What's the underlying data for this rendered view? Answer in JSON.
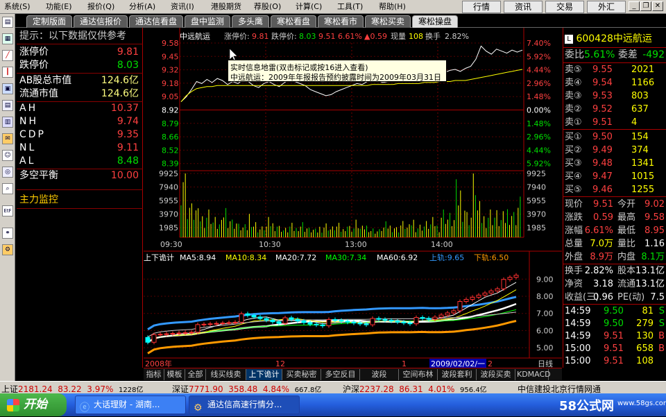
{
  "menu": {
    "items": [
      "系统(S)",
      "功能(E)",
      "报价(Q)",
      "分析(A)",
      "资讯(I)",
      "港股期货",
      "荐股(O)",
      "计算(C)",
      "工具(T)",
      "帮助(H)"
    ],
    "right_buttons": [
      "行情",
      "资讯",
      "交易",
      "外汇"
    ]
  },
  "tabs": [
    "定制版面",
    "通达信报价",
    "通达信看盘",
    "盘中监测",
    "多头鹰",
    "寒松看盘",
    "寒松看市",
    "寒松买卖",
    "寒松操盘"
  ],
  "active_tab": "寒松操盘",
  "left_panel": {
    "notice": "提示：以下数据仅供参考",
    "rows": [
      {
        "label": "涨停价",
        "value": "9.81",
        "color": "#ff4040"
      },
      {
        "label": "跌停价",
        "value": "8.03",
        "color": "#00e000"
      }
    ],
    "cap_rows": [
      {
        "label": "AB股总市值",
        "value": "124.6亿"
      },
      {
        "label": "流通市值",
        "value": "124.6亿"
      }
    ],
    "indicators": [
      {
        "label": "AH",
        "value": "10.37",
        "color": "#ff4040"
      },
      {
        "label": "NH",
        "value": "9.74",
        "color": "#ff4040"
      },
      {
        "label": "CDP",
        "value": "9.35",
        "color": "#ff4040"
      },
      {
        "label": "NL",
        "value": "9.11",
        "color": "#ff4040"
      },
      {
        "label": "AL",
        "value": "8.48",
        "color": "#00e000"
      }
    ],
    "balance": {
      "label": "多空平衡",
      "value": "10.00"
    },
    "monitor_label": "主力监控"
  },
  "intraday": {
    "header": {
      "name": "中远航运",
      "limit_up_label": "涨停价:",
      "limit_up": "9.81",
      "limit_down_label": "跌停价:",
      "limit_down": "8.03",
      "price": "9.51",
      "pct": "6.61%",
      "change": "▲0.59",
      "volume_label": "现量",
      "volume": "108",
      "turnover_label": "换手",
      "turnover": "2.82%"
    },
    "price_ticks": [
      "9.58",
      "9.45",
      "9.32",
      "9.18",
      "9.05",
      "8.92",
      "8.79",
      "8.66",
      "8.52",
      "8.39"
    ],
    "pct_ticks": [
      "7.40%",
      "5.92%",
      "4.44%",
      "2.96%",
      "1.48%",
      "0.00%",
      "1.48%",
      "2.96%",
      "4.44%",
      "5.92%"
    ],
    "vol_ticks": [
      "9925",
      "7940",
      "5955",
      "3970",
      "1985"
    ],
    "time_ticks": [
      "09:30",
      "10:30",
      "13:00",
      "14:00"
    ],
    "price_path": [
      9.0,
      9.05,
      9.12,
      9.2,
      9.18,
      9.22,
      9.19,
      9.23,
      9.21,
      9.17,
      9.2,
      9.18,
      9.22,
      9.2,
      9.16,
      9.14,
      9.18,
      9.2,
      9.17,
      9.15,
      9.19,
      9.22,
      9.2,
      9.18,
      9.16,
      9.12,
      9.1,
      9.08,
      9.06,
      9.07,
      9.1,
      9.12,
      9.14,
      9.16,
      9.18,
      9.17,
      9.2,
      9.22,
      9.21,
      9.19,
      9.2,
      9.22,
      9.24,
      9.23,
      9.25,
      9.24,
      9.26,
      9.25,
      9.27,
      9.28,
      9.3,
      9.29,
      9.31,
      9.32,
      9.3,
      9.33,
      9.35,
      9.42,
      9.55,
      9.5,
      9.47,
      9.52,
      9.5,
      9.48,
      9.51,
      9.49,
      9.51
    ],
    "avg_path": [
      9.0,
      9.06,
      9.1,
      9.13,
      9.14,
      9.15,
      9.15,
      9.16,
      9.16,
      9.16,
      9.16,
      9.16,
      9.16,
      9.16,
      9.16,
      9.16,
      9.16,
      9.16,
      9.16,
      9.16,
      9.16,
      9.16,
      9.16,
      9.16,
      9.16,
      9.16,
      9.16,
      9.16,
      9.16,
      9.16,
      9.16,
      9.16,
      9.16,
      9.16,
      9.16,
      9.16,
      9.16,
      9.17,
      9.17,
      9.17,
      9.17,
      9.17,
      9.18,
      9.18,
      9.18,
      9.18,
      9.18,
      9.19,
      9.19,
      9.19,
      9.2,
      9.2,
      9.2,
      9.21,
      9.21,
      9.21,
      9.22,
      9.23,
      9.24,
      9.25,
      9.26,
      9.27,
      9.28,
      9.29,
      9.3,
      9.31,
      9.32
    ],
    "volumes": [
      62,
      30,
      25,
      20,
      18,
      22,
      15,
      12,
      25,
      18,
      14,
      10,
      9,
      20,
      12,
      8,
      10,
      14,
      12,
      9,
      7,
      10,
      8,
      12,
      9,
      7,
      6,
      9,
      11,
      8,
      10,
      7,
      12,
      9,
      13,
      8,
      10,
      7,
      6,
      9,
      11,
      10,
      8,
      12,
      9,
      15,
      10,
      11,
      12,
      14,
      10,
      22,
      18,
      16,
      40,
      30,
      20,
      60,
      25,
      18,
      22,
      20,
      16,
      18,
      24,
      20,
      30
    ]
  },
  "tooltip": {
    "title": "实时信息地雷(双击标记或按16进入查看)",
    "body": "中远航运：2009年年报报告预约披露时间为2009年03月31日"
  },
  "kline": {
    "legend": [
      {
        "label": "上下诡计",
        "color": "#ffffff"
      },
      {
        "label": "MA5:8.94",
        "color": "#ffffff"
      },
      {
        "label": "MA10:8.34",
        "color": "#ffff00"
      },
      {
        "label": "MA20:7.72",
        "color": "#ffffff"
      },
      {
        "label": "MA30:7.34",
        "color": "#00ff00"
      },
      {
        "label": "MA60:6.92",
        "color": "#ffffff"
      },
      {
        "label": "上轨:9.65",
        "color": "#3399ff"
      },
      {
        "label": "下轨:6.50",
        "color": "#ff9900"
      }
    ],
    "y_ticks": [
      "9.00",
      "8.00",
      "7.00",
      "6.00",
      "5.00"
    ],
    "date_labels": [
      "2008年",
      "12",
      "1",
      "2009/02/02/一",
      "2"
    ],
    "period": "日线"
  },
  "bottom_tabs": [
    "指标",
    "模板",
    "全部",
    "线买线卖",
    "上下诡计",
    "买卖秘密",
    "多空反目",
    "波段MACD",
    "空间布林",
    "波段套利",
    "波段买卖",
    "KDMACD"
  ],
  "active_bottom_tab": "上下诡计",
  "right_panel": {
    "code": "600428",
    "name": "中远航运",
    "wei_bi": {
      "label": "委比",
      "value": "5.61%",
      "label2": "委差",
      "value2": "-492"
    },
    "sells": [
      {
        "label": "卖⑤",
        "price": "9.55",
        "vol": "2021"
      },
      {
        "label": "卖④",
        "price": "9.54",
        "vol": "1166"
      },
      {
        "label": "卖③",
        "price": "9.53",
        "vol": "803"
      },
      {
        "label": "卖②",
        "price": "9.52",
        "vol": "637"
      },
      {
        "label": "卖①",
        "price": "9.51",
        "vol": "4"
      }
    ],
    "buys": [
      {
        "label": "买①",
        "price": "9.50",
        "vol": "154"
      },
      {
        "label": "买②",
        "price": "9.49",
        "vol": "374"
      },
      {
        "label": "买③",
        "price": "9.48",
        "vol": "1341"
      },
      {
        "label": "买④",
        "price": "9.47",
        "vol": "1015"
      },
      {
        "label": "买⑤",
        "price": "9.46",
        "vol": "1255"
      }
    ],
    "stats": [
      {
        "l1": "现价",
        "v1": "9.51",
        "c1": "#ff4040",
        "l2": "今开",
        "v2": "9.02",
        "c2": "#ff4040"
      },
      {
        "l1": "涨跌",
        "v1": "0.59",
        "c1": "#ff4040",
        "l2": "最高",
        "v2": "9.58",
        "c2": "#ff4040"
      },
      {
        "l1": "涨幅",
        "v1": "6.61%",
        "c1": "#ff4040",
        "l2": "最低",
        "v2": "8.95",
        "c2": "#ff4040"
      },
      {
        "l1": "总量",
        "v1": "7.0万",
        "c1": "#ffff00",
        "l2": "量比",
        "v2": "1.16",
        "c2": "#ffffff"
      },
      {
        "l1": "外盘",
        "v1": "8.9万",
        "c1": "#ff4040",
        "l2": "内盘",
        "v2": "8.1万",
        "c2": "#00e000"
      }
    ],
    "stats2": [
      {
        "l1": "换手",
        "v1": "2.82%",
        "l2": "股本",
        "v2": "13.1亿"
      },
      {
        "l1": "净资",
        "v1": "3.18",
        "l2": "流通",
        "v2": "13.1亿"
      },
      {
        "l1": "收益(三)",
        "v1": "0.96",
        "l2": "PE(动)",
        "v2": "7.5"
      }
    ],
    "ticks": [
      {
        "time": "14:59",
        "price": "9.50",
        "vol": "81",
        "dir": "S",
        "color": "#00e000"
      },
      {
        "time": "14:59",
        "price": "9.50",
        "vol": "279",
        "dir": "S",
        "color": "#00e000"
      },
      {
        "time": "14:59",
        "price": "9.51",
        "vol": "130",
        "dir": "B",
        "color": "#ff4040"
      },
      {
        "time": "15:00",
        "price": "9.51",
        "vol": "658",
        "dir": "B",
        "color": "#ff4040"
      },
      {
        "time": "15:00",
        "price": "9.51",
        "vol": "108",
        "dir": "",
        "color": "#ff4040"
      }
    ]
  },
  "status": {
    "items": [
      {
        "label": "上证",
        "value": "2181.24",
        "change": "83.22",
        "pct": "3.97%",
        "amount": "1228亿"
      },
      {
        "label": "深证",
        "value": "7771.90",
        "change": "358.48",
        "pct": "4.84%",
        "amount": "667.8亿"
      },
      {
        "label": "沪深",
        "value": "2237.28",
        "change": "86.31",
        "pct": "4.01%",
        "amount": "956.4亿"
      }
    ],
    "broker": "中信建投北京行情网通"
  },
  "taskbar": {
    "start": "开始",
    "tasks": [
      "大话理财 - 湖南...",
      "通达信高速行情分..."
    ],
    "watermark": "58公式网",
    "watermark_url": "www.58gs.com"
  },
  "colors": {
    "up": "#ff4040",
    "down": "#00e000",
    "bg": "#000000",
    "grid": "#aa0000"
  }
}
